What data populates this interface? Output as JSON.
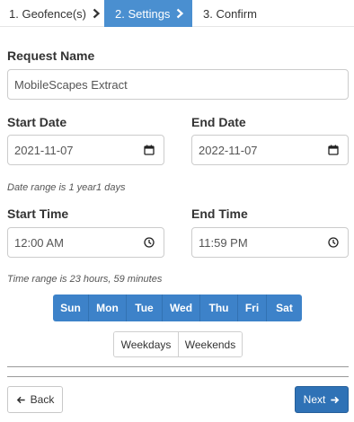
{
  "steps": [
    {
      "label": "1. Geofence(s)"
    },
    {
      "label": "2. Settings"
    },
    {
      "label": "3. Confirm"
    }
  ],
  "form": {
    "request_name_label": "Request Name",
    "request_name_value": "MobileScapes Extract",
    "start_date_label": "Start Date",
    "start_date_value": "2021-11-07",
    "end_date_label": "End Date",
    "end_date_value": "2022-11-07",
    "date_range_hint": "Date range is 1 year1 days",
    "start_time_label": "Start Time",
    "start_time_value": "12:00 AM",
    "end_time_label": "End Time",
    "end_time_value": "11:59 PM",
    "time_range_hint": "Time range is 23 hours, 59 minutes"
  },
  "days": [
    "Sun",
    "Mon",
    "Tue",
    "Wed",
    "Thu",
    "Fri",
    "Sat"
  ],
  "presets": {
    "weekdays": "Weekdays",
    "weekends": "Weekends"
  },
  "nav": {
    "back": "Back",
    "next": "Next"
  },
  "icons": {
    "step_chevron": "chevron-right-icon",
    "date": "calendar-icon",
    "time": "clock-icon",
    "back": "arrow-left-icon",
    "next": "arrow-right-icon"
  },
  "colors": {
    "active_step": "#4a8fd0",
    "day_selected": "#3d82c9",
    "next_button": "#2f72b6"
  }
}
